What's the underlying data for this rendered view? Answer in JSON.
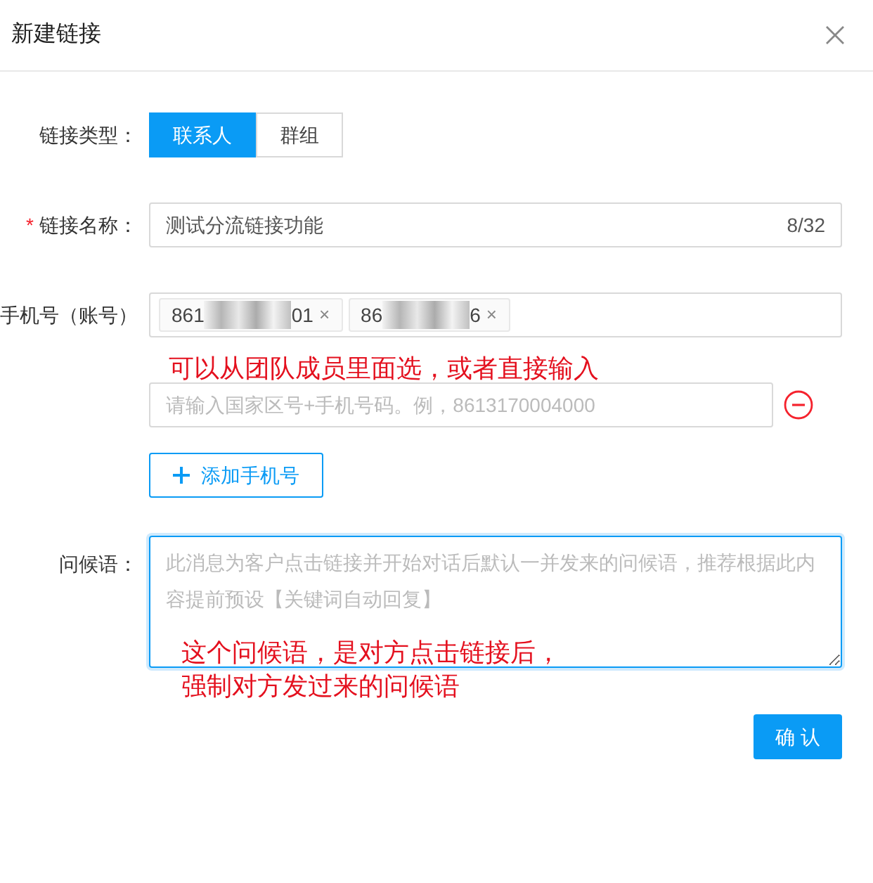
{
  "dialog": {
    "title": "新建链接"
  },
  "link_type": {
    "label": "链接类型：",
    "options": [
      {
        "label": "联系人",
        "selected": true
      },
      {
        "label": "群组",
        "selected": false
      }
    ]
  },
  "link_name": {
    "label": "链接名称：",
    "required": true,
    "required_mark": "*",
    "value": "测试分流链接功能",
    "counter": "8/32"
  },
  "phone": {
    "label": "手机号（账号）",
    "tags": [
      {
        "prefix": "861",
        "suffix": "01",
        "remove": "×"
      },
      {
        "prefix": "86",
        "suffix": "6",
        "remove": "×"
      }
    ],
    "new_field": {
      "placeholder": "请输入国家区号+手机号码。例，8613170004000"
    },
    "add_button": "添加手机号"
  },
  "greeting": {
    "label": "问候语：",
    "placeholder": "此消息为客户点击链接并开始对话后默认一并发来的问候语，推荐根据此内容提前预设【关键词自动回复】",
    "focused": true
  },
  "confirm_button": "确 认",
  "annotations": [
    {
      "text": "可以从团队成员里面选，或者直接输入"
    },
    {
      "lines": [
        "这个问候语，是对方点击链接后，",
        "强制对方发过来的问候语"
      ]
    }
  ]
}
